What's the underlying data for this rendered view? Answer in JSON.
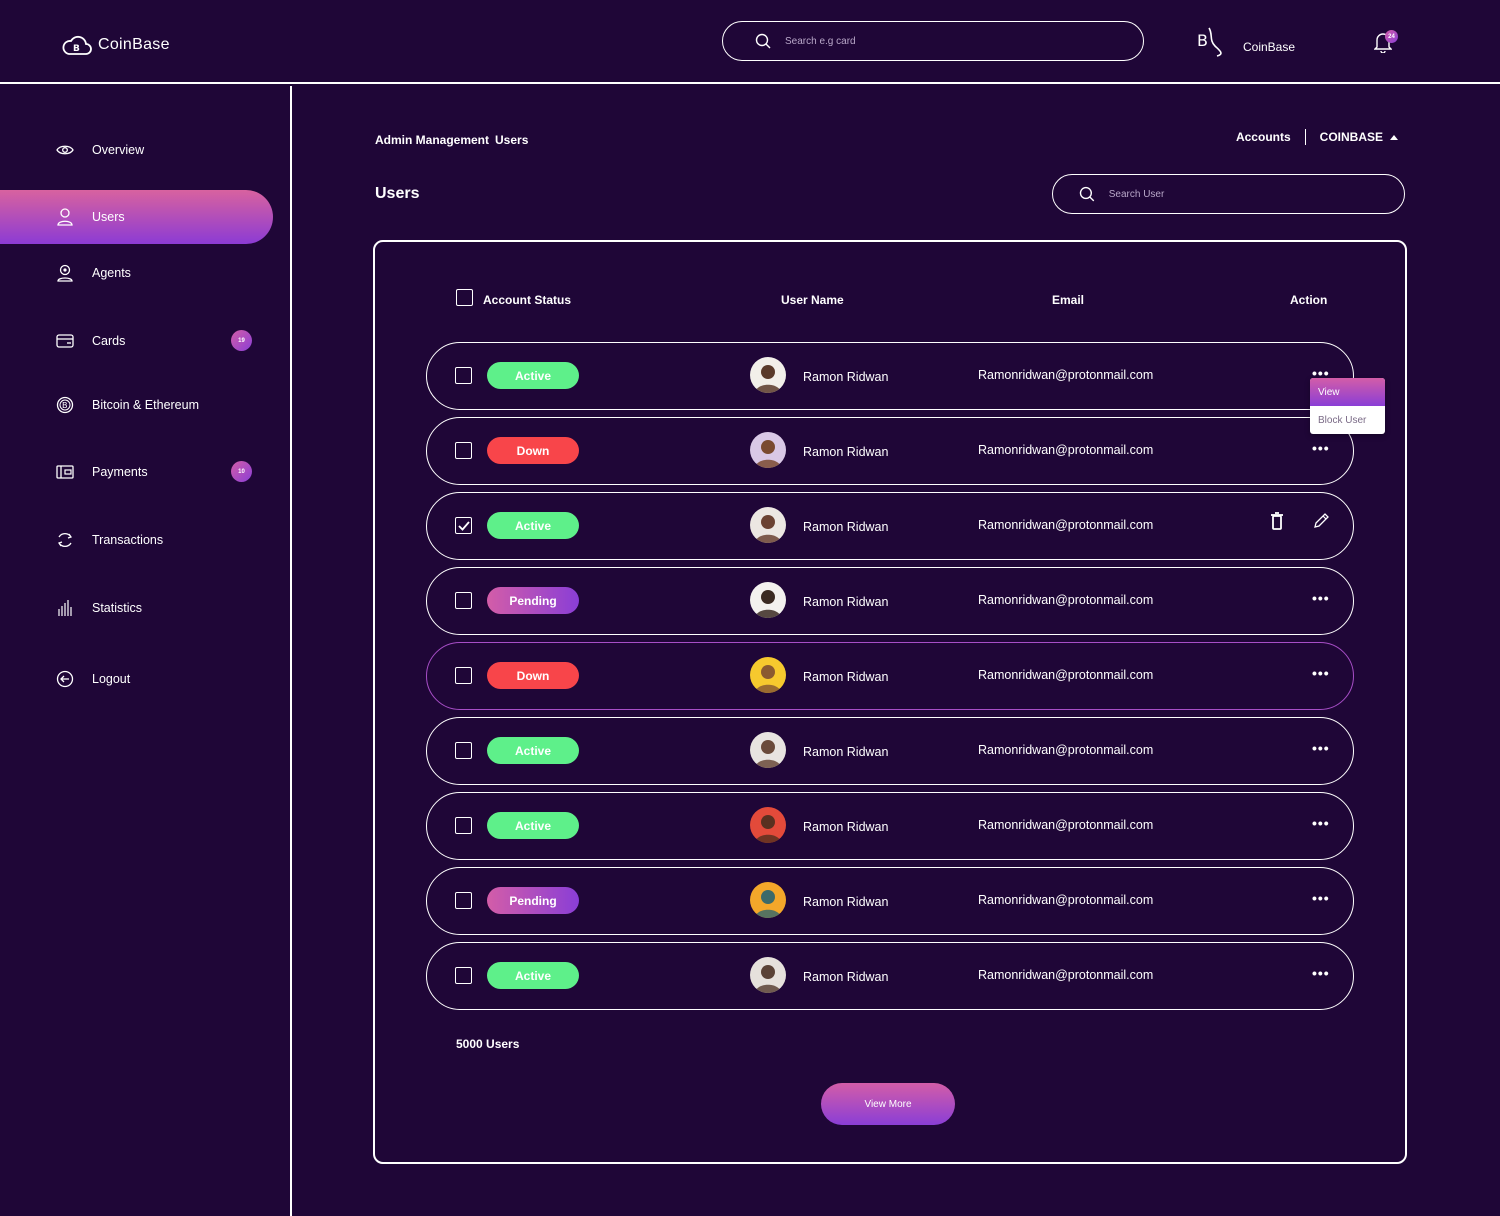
{
  "header": {
    "logo_text": "CoinBase",
    "search_placeholder": "Search e.g card",
    "brand_name": "CoinBase",
    "notification_count": "24"
  },
  "sidebar": {
    "items": [
      {
        "label": "Overview",
        "icon": "eye-icon"
      },
      {
        "label": "Users",
        "icon": "user-icon",
        "active": true
      },
      {
        "label": "Agents",
        "icon": "agent-icon"
      },
      {
        "label": "Cards",
        "icon": "card-icon",
        "badge": "19"
      },
      {
        "label": "Bitcoin & Ethereum",
        "icon": "bitcoin-icon"
      },
      {
        "label": "Payments",
        "icon": "wallet-icon",
        "badge": "10"
      },
      {
        "label": "Transactions",
        "icon": "transactions-icon"
      },
      {
        "label": "Statistics",
        "icon": "statistics-icon"
      },
      {
        "label": "Logout",
        "icon": "logout-icon"
      }
    ]
  },
  "breadcrumb": {
    "section": "Admin Management",
    "page": "Users"
  },
  "account_switch": {
    "accounts_label": "Accounts",
    "org_label": "COINBASE"
  },
  "page_title": "Users",
  "user_search_placeholder": "Search User",
  "table": {
    "headers": {
      "status": "Account Status",
      "name": "User Name",
      "email": "Email",
      "action": "Action"
    },
    "rows": [
      {
        "status": "Active",
        "name": "Ramon Ridwan",
        "email": "Ramonridwan@protonmail.com",
        "checked": false
      },
      {
        "status": "Down",
        "name": "Ramon Ridwan",
        "email": "Ramonridwan@protonmail.com",
        "checked": false
      },
      {
        "status": "Active",
        "name": "Ramon Ridwan",
        "email": "Ramonridwan@protonmail.com",
        "checked": true
      },
      {
        "status": "Pending",
        "name": "Ramon Ridwan",
        "email": "Ramonridwan@protonmail.com",
        "checked": false
      },
      {
        "status": "Down",
        "name": "Ramon Ridwan",
        "email": "Ramonridwan@protonmail.com",
        "checked": false
      },
      {
        "status": "Active",
        "name": "Ramon Ridwan",
        "email": "Ramonridwan@protonmail.com",
        "checked": false
      },
      {
        "status": "Active",
        "name": "Ramon Ridwan",
        "email": "Ramonridwan@protonmail.com",
        "checked": false
      },
      {
        "status": "Pending",
        "name": "Ramon Ridwan",
        "email": "Ramonridwan@protonmail.com",
        "checked": false
      },
      {
        "status": "Active",
        "name": "Ramon Ridwan",
        "email": "Ramonridwan@protonmail.com",
        "checked": false
      }
    ]
  },
  "row_menu": {
    "view": "View",
    "block": "Block User"
  },
  "total_users": "5000 Users",
  "view_more": "View More",
  "colors": {
    "background": "#1f0637",
    "active": "#5ef08a",
    "down": "#f8454a",
    "accent_start": "#d35da8",
    "accent_end": "#8a3ed6"
  }
}
